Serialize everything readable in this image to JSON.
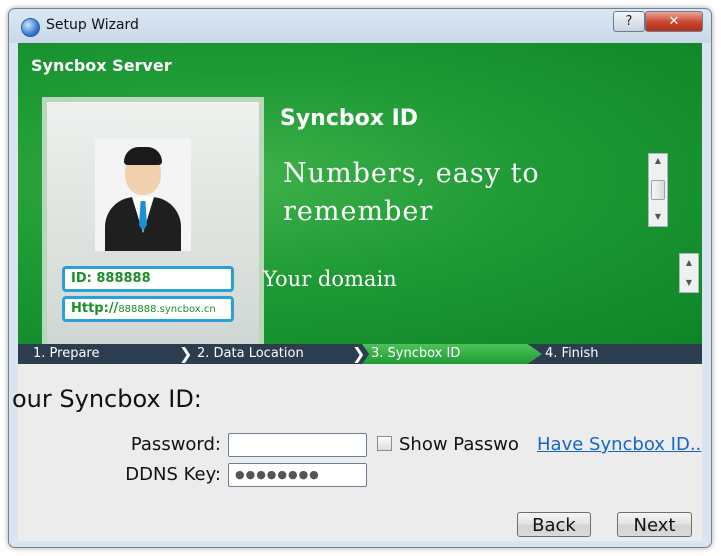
{
  "window": {
    "title": "Setup Wizard",
    "help_label": "?",
    "close_label": "✕"
  },
  "banner": {
    "brand": "Syncbox Server",
    "heading": "Syncbox ID",
    "text_primary": "Numbers, easy to remember",
    "text_secondary": "Your domain",
    "card": {
      "id_label": "ID: 888888",
      "url_prefix": "Http://",
      "url_domain": "888888.syncbox.cn"
    }
  },
  "steps": [
    {
      "label": "1. Prepare",
      "active": false
    },
    {
      "label": "2. Data Location",
      "active": false
    },
    {
      "label": "3. Syncbox ID",
      "active": true
    },
    {
      "label": "4. Finish",
      "active": false
    }
  ],
  "form": {
    "heading": "our Syncbox ID:",
    "password_label": "Password:",
    "password_value": "",
    "show_password_label": "Show Passwo",
    "show_password_checked": false,
    "have_id_link": "Have Syncbox ID..",
    "ddns_label": "DDNS Key:",
    "ddns_value": "●●●●●●●●"
  },
  "buttons": {
    "back": "Back",
    "next": "Next"
  },
  "colors": {
    "banner_green": "#1e9a35",
    "step_bar": "#2c3d4f",
    "link": "#1567c6"
  }
}
